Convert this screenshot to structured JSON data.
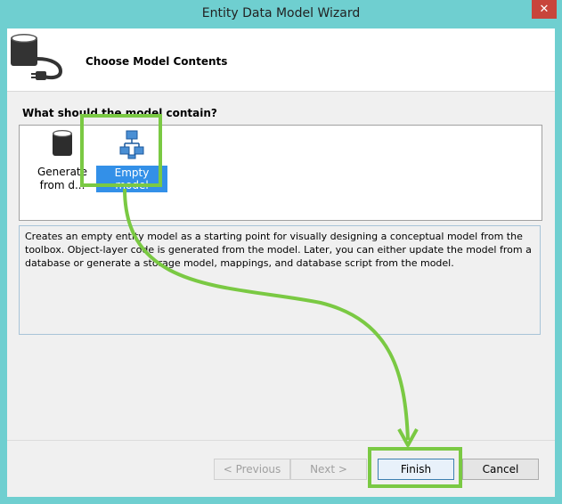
{
  "window": {
    "title": "Entity Data Model Wizard",
    "close_glyph": "✕"
  },
  "header": {
    "title": "Choose Model Contents",
    "icon": "database-plug-icon"
  },
  "question": "What should the model contain?",
  "list": {
    "items": [
      {
        "label": "Generate\nfrom d...",
        "icon": "database-icon",
        "selected": false
      },
      {
        "label": "Empty model",
        "icon": "model-diagram-icon",
        "selected": true
      }
    ]
  },
  "description": "Creates an empty entity model as a starting point for visually designing a conceptual model from the toolbox. Object-layer code is generated from the model. Later, you can either update the model from a database or generate a storage model, mappings, and database script from the model.",
  "buttons": {
    "previous": "< Previous",
    "next": "Next >",
    "finish": "Finish",
    "cancel": "Cancel"
  },
  "annotation": {
    "highlight_color": "#7ac943"
  }
}
